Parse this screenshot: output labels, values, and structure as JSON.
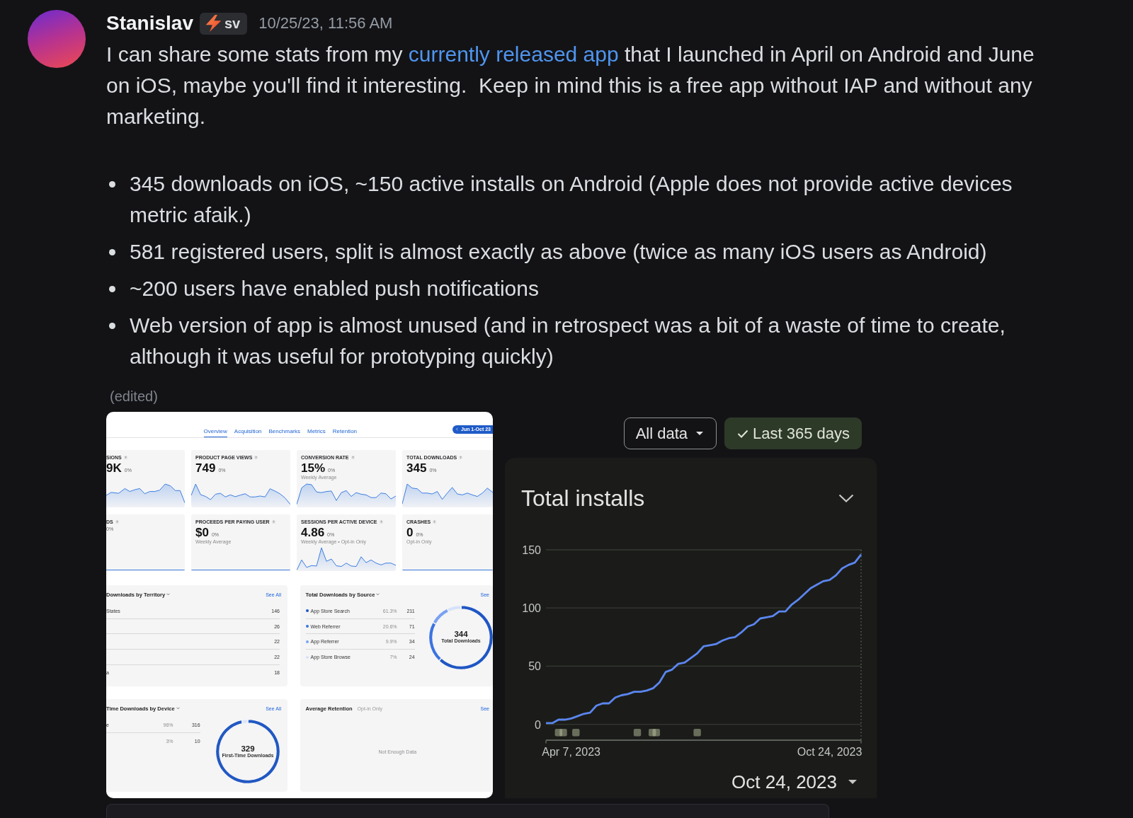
{
  "message": {
    "author": "Stanislav",
    "tag": "sv",
    "timestamp": "10/25/23, 11:56 AM",
    "body": [
      {
        "kind": "text",
        "text": "I can share some stats from my "
      },
      {
        "kind": "link",
        "text": "currently released app"
      },
      {
        "kind": "text",
        "text": " that I launched in April on Android and June on iOS, maybe you'll find it interesting.  Keep in mind this is a free app without IAP and without any marketing."
      }
    ],
    "bullets": [
      "345 downloads on iOS, ~150 active installs on Android (Apple does not provide active devices metric afaik.)",
      "581 registered users, split is almost exactly as above (twice as many iOS users as Android)",
      "~200 users have enabled push notifications",
      "Web version of app is almost unused (and in retrospect was a bit of a waste of time to create, although it was useful for prototyping quickly)"
    ],
    "edited": "(edited)"
  },
  "app_store_screenshot": {
    "tabs": [
      {
        "label": "Overview",
        "selected": true
      },
      {
        "label": "Acquisition",
        "selected": false
      },
      {
        "label": "Benchmarks",
        "selected": false
      },
      {
        "label": "Metrics",
        "selected": false
      },
      {
        "label": "Retention",
        "selected": false
      }
    ],
    "date_range": "Jun 1-Oct 23",
    "metrics": [
      {
        "label": "SIONS",
        "value": "9K",
        "change": "0%"
      },
      {
        "label": "PRODUCT PAGE VIEWS",
        "value": "749",
        "change": "0%"
      },
      {
        "label": "CONVERSION RATE",
        "value": "15%",
        "change": "0%",
        "note": "Weekly Average"
      },
      {
        "label": "TOTAL DOWNLOADS",
        "value": "345",
        "change": "0%"
      },
      {
        "label": "DS",
        "change": "0%"
      },
      {
        "label": "PROCEEDS PER PAYING USER",
        "value": "$0",
        "change": "0%",
        "note": "Weekly Average"
      },
      {
        "label": "SESSIONS PER ACTIVE DEVICE",
        "value": "4.86",
        "change": "0%",
        "note": "Weekly Average • Opt-in Only"
      },
      {
        "label": "CRASHES",
        "value": "0",
        "change": "0%",
        "note": "Opt-in Only"
      }
    ],
    "territory_panel": {
      "title": "Downloads by Territory",
      "link": "See All",
      "rows": [
        {
          "name": "States",
          "count": "146"
        },
        {
          "count": "26"
        },
        {
          "count": "22"
        },
        {
          "count": "22"
        },
        {
          "name": "a",
          "count": "18"
        }
      ]
    },
    "source_panel": {
      "title": "Total Downloads by Source",
      "link": "See",
      "rows": [
        {
          "name": "App Store Search",
          "share": "61.3%",
          "count": "211",
          "color": "#1f56c4"
        },
        {
          "name": "Web Referrer",
          "share": "20.6%",
          "count": "71",
          "color": "#3b74e0"
        },
        {
          "name": "App Referrer",
          "share": "9.9%",
          "count": "34",
          "color": "#7ba2f2"
        },
        {
          "name": "App Store Browse",
          "share": "7%",
          "count": "24",
          "color": "#d6e2fb"
        }
      ],
      "total": "344",
      "total_label": "Total Downloads",
      "chart_data": {
        "type": "donut",
        "values": [
          61.3,
          20.6,
          9.9,
          7
        ]
      }
    },
    "device_panel": {
      "title": "Time Downloads by Device",
      "link": "See All",
      "rows": [
        {
          "name": "e",
          "share": "96%",
          "count": "316"
        },
        {
          "share": "3%",
          "count": "10"
        }
      ],
      "total": "329",
      "total_label": "First-Time Downloads",
      "chart_data": {
        "type": "donut",
        "values": [
          96,
          3
        ]
      }
    },
    "retention_panel": {
      "title": "Average Retention",
      "note": "Opt-in Only",
      "link": "See",
      "empty_text": "Not Enough Data"
    }
  },
  "play_console_screenshot": {
    "filters": [
      {
        "label": "All data",
        "kind": "dropdown",
        "selected": false
      },
      {
        "label": "Last 365 days",
        "kind": "chip",
        "selected": true
      }
    ],
    "card": {
      "title": "Total installs",
      "date": "Oct 24, 2023",
      "chart_data": {
        "type": "line",
        "categories": [
          null,
          null,
          null,
          null,
          "Apr 7, 2023",
          null,
          null,
          null,
          null,
          null,
          null,
          null,
          null,
          null,
          null,
          null,
          null,
          null,
          null,
          null,
          null,
          null,
          null,
          null,
          null,
          null,
          null,
          null,
          null,
          null,
          null,
          null,
          null,
          null,
          null,
          null,
          null,
          null,
          null,
          null,
          null,
          null,
          null,
          null,
          null,
          "Oct 24, 2023",
          null,
          null,
          null,
          null,
          null
        ],
        "series": [
          {
            "color": "#5b86f0",
            "values": [
              1,
              1,
              4,
              4,
              5,
              7,
              9,
              10,
              16,
              18,
              18,
              23,
              25,
              26,
              28,
              28,
              29,
              31,
              36,
              45,
              47,
              52,
              53,
              57,
              61,
              67,
              68,
              69,
              72,
              74,
              75,
              79,
              84,
              86,
              91,
              92,
              93,
              97,
              97,
              103,
              107,
              112,
              117,
              120,
              123,
              124,
              128,
              134,
              137,
              139,
              146
            ]
          }
        ],
        "ylim": [
          0,
          150
        ],
        "yticks": [
          0,
          50,
          100,
          150
        ]
      }
    }
  }
}
